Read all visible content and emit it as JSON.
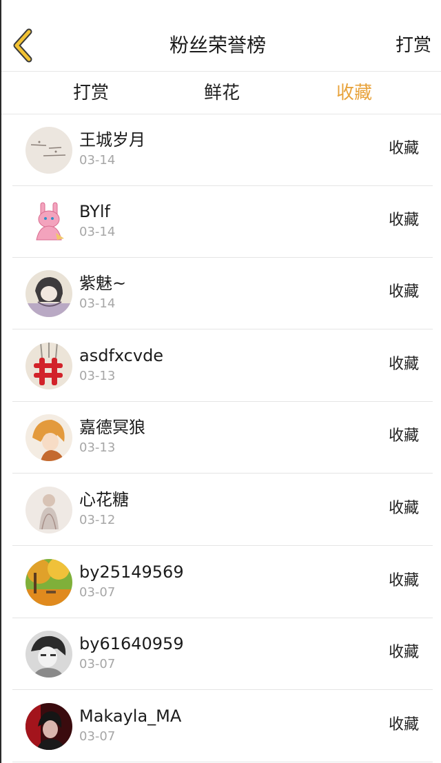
{
  "header": {
    "title": "粉丝荣誉榜",
    "right_action": "打赏",
    "back_icon": "chevron-left-icon",
    "accent_color": "#e8a33c"
  },
  "tabs": [
    {
      "label": "打赏",
      "active": false
    },
    {
      "label": "鲜花",
      "active": false
    },
    {
      "label": "收藏",
      "active": true
    }
  ],
  "fans": [
    {
      "name": "王城岁月",
      "date": "03-14",
      "action": "收藏",
      "avatar": "handwriting-note-avatar"
    },
    {
      "name": "BYlf",
      "date": "03-14",
      "action": "收藏",
      "avatar": "pink-bunny-avatar"
    },
    {
      "name": "紫魅~",
      "date": "03-14",
      "action": "收藏",
      "avatar": "girl-sketch-avatar"
    },
    {
      "name": "asdfxcvde",
      "date": "03-13",
      "action": "收藏",
      "avatar": "red-knot-avatar"
    },
    {
      "name": "嘉德冥狼",
      "date": "03-13",
      "action": "收藏",
      "avatar": "anime-character-avatar"
    },
    {
      "name": "心花糖",
      "date": "03-12",
      "action": "收藏",
      "avatar": "doll-figure-avatar"
    },
    {
      "name": "by25149569",
      "date": "03-07",
      "action": "收藏",
      "avatar": "autumn-park-avatar"
    },
    {
      "name": "by61640959",
      "date": "03-07",
      "action": "收藏",
      "avatar": "bw-portrait-avatar"
    },
    {
      "name": "Makayla_MA",
      "date": "03-07",
      "action": "收藏",
      "avatar": "dark-red-portrait-avatar"
    }
  ]
}
